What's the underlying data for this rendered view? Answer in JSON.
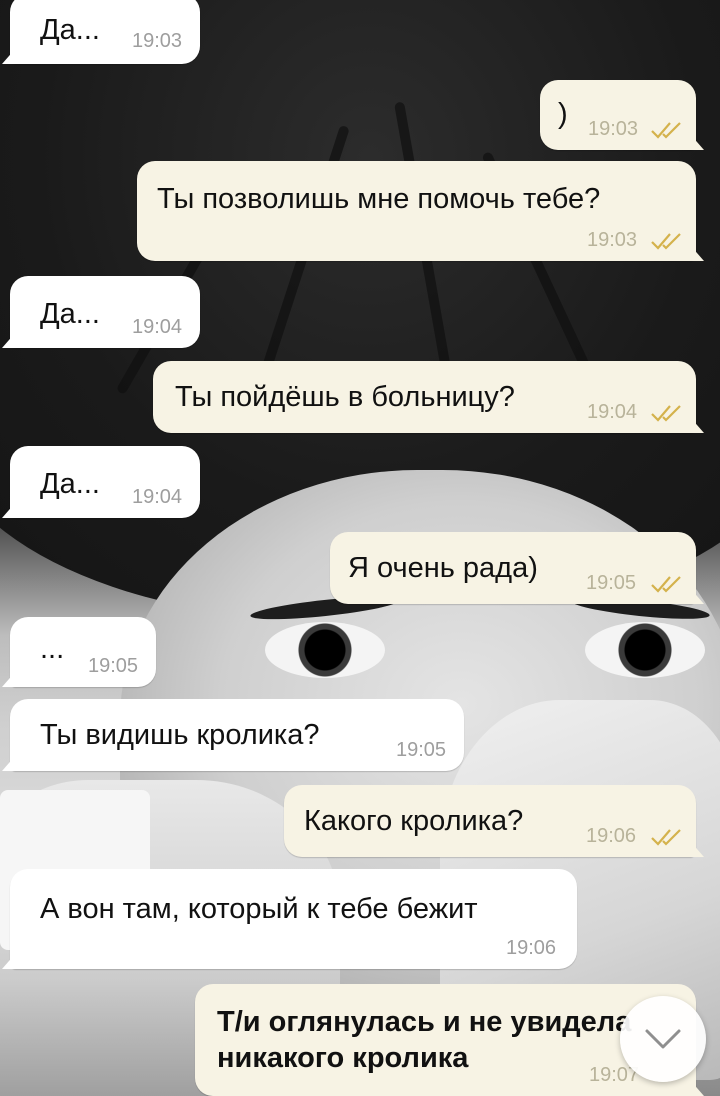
{
  "messages": [
    {
      "text": "Да...",
      "time": "19:03",
      "direction": "in"
    },
    {
      "text": ")",
      "time": "19:03",
      "direction": "out",
      "status": "read"
    },
    {
      "text": "Ты позволишь мне помочь тебе?",
      "time": "19:03",
      "direction": "out",
      "status": "read"
    },
    {
      "text": "Да...",
      "time": "19:04",
      "direction": "in"
    },
    {
      "text": "Ты пойдёшь в больницу?",
      "time": "19:04",
      "direction": "out",
      "status": "read"
    },
    {
      "text": "Да...",
      "time": "19:04",
      "direction": "in"
    },
    {
      "text": "Я очень рада)",
      "time": "19:05",
      "direction": "out",
      "status": "read"
    },
    {
      "text": "...",
      "time": "19:05",
      "direction": "in"
    },
    {
      "text": "Ты видишь кролика?",
      "time": "19:05",
      "direction": "in"
    },
    {
      "text": "Какого кролика?",
      "time": "19:06",
      "direction": "out",
      "status": "read"
    },
    {
      "text": "А вон там, который к тебе бежит",
      "time": "19:06",
      "direction": "in"
    },
    {
      "text_line1": "Т/и оглянулась и не увидела",
      "text_line2": "никакого кролика",
      "time": "19:07",
      "direction": "out",
      "status": "read"
    }
  ],
  "icons": {
    "read_ticks": "double-check-icon",
    "scroll_down": "chevron-down-icon"
  },
  "colors": {
    "incoming_bubble": "#ffffff",
    "outgoing_bubble": "#f7f3e4",
    "read_ticks": "#d4b24c"
  }
}
